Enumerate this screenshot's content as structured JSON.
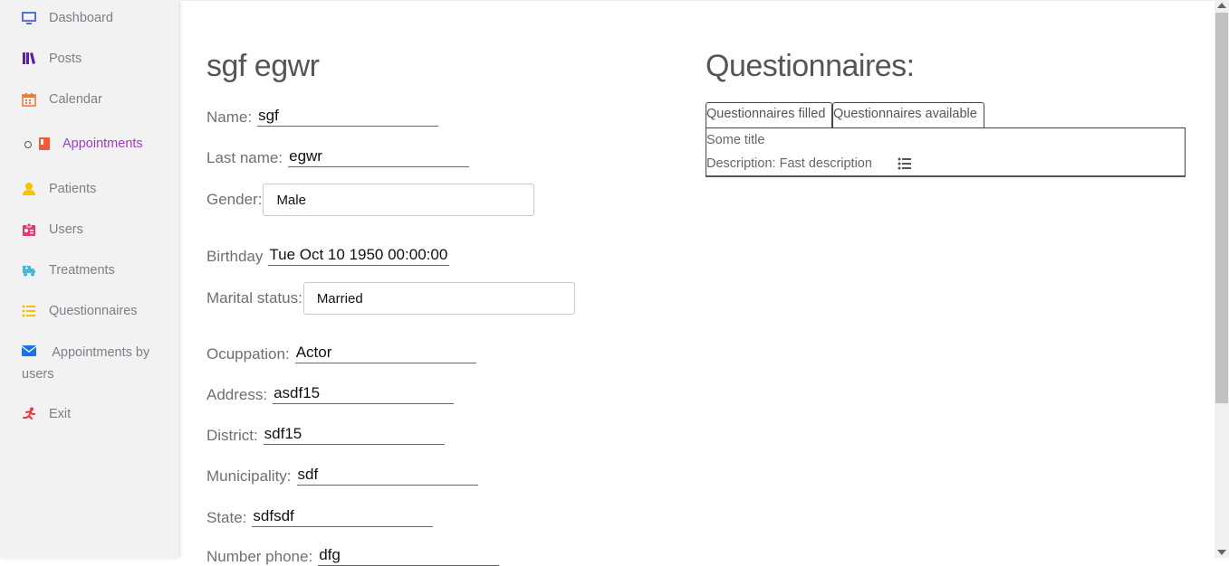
{
  "sidebar": {
    "items": [
      {
        "label": "Dashboard",
        "icon": "monitor-icon",
        "color": "#5b6fd6"
      },
      {
        "label": "Posts",
        "icon": "books-icon",
        "color": "#5a1fa8"
      },
      {
        "label": "Calendar",
        "icon": "calendar-icon",
        "color": "#f07a35"
      },
      {
        "label": "Appointments",
        "icon": "book-icon",
        "color": "#f05a3a",
        "active": true
      },
      {
        "label": "Patients",
        "icon": "user-icon",
        "color": "#f5c200"
      },
      {
        "label": "Users",
        "icon": "id-card-icon",
        "color": "#e63a66"
      },
      {
        "label": "Treatments",
        "icon": "truck-icon",
        "color": "#3fb9e6"
      },
      {
        "label": "Questionnaires",
        "icon": "list-icon",
        "color": "#f5c200"
      },
      {
        "label": "Appointments by users",
        "icon": "envelope-icon",
        "color": "#1a73e8"
      },
      {
        "label": "Exit",
        "icon": "running-icon",
        "color": "#e63a3a"
      }
    ]
  },
  "patient": {
    "full_name": "sgf egwr",
    "name_label": "Name:",
    "name": "sgf",
    "last_name_label": "Last name:",
    "last_name": "egwr",
    "gender_label": "Gender:",
    "gender": "Male",
    "birthday_label": "Birthday",
    "birthday": "Tue Oct 10 1950 00:00:00",
    "marital_label": "Marital status:",
    "marital": "Married",
    "occupation_label": "Ocuppation:",
    "occupation": "Actor",
    "address_label": "Address:",
    "address": "asdf15",
    "district_label": "District:",
    "district": "sdf15",
    "municipality_label": "Municipality:",
    "municipality": "sdf",
    "state_label": "State:",
    "state": "sdfsdf",
    "phone_label": "Number phone:",
    "phone": "dfg"
  },
  "questionnaires": {
    "title": "Questionnaires:",
    "tab_filled": "Questionnaires filled",
    "tab_available": "Questionnaires available",
    "item_title": "Some title",
    "item_description": "Description: Fast description"
  }
}
